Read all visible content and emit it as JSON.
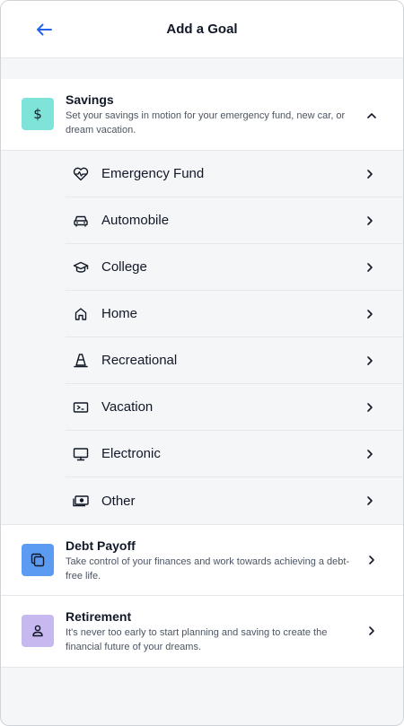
{
  "header": {
    "title": "Add a Goal",
    "back_icon": "arrow-left-icon"
  },
  "colors": {
    "accent": "#2563eb",
    "savings_icon_bg": "#7ee3d8",
    "debt_icon_bg": "#5b9cf2",
    "retirement_icon_bg": "#c7b8ef"
  },
  "savings": {
    "title": "Savings",
    "description": "Set your savings in motion for your emergency fund, new car, or dream vacation.",
    "icon": "dollar-icon",
    "expanded": true,
    "items": [
      {
        "label": "Emergency Fund",
        "icon": "heart-pulse-icon"
      },
      {
        "label": "Automobile",
        "icon": "car-icon"
      },
      {
        "label": "College",
        "icon": "graduation-cap-icon"
      },
      {
        "label": "Home",
        "icon": "home-icon"
      },
      {
        "label": "Recreational",
        "icon": "traffic-cone-icon"
      },
      {
        "label": "Vacation",
        "icon": "ticket-icon"
      },
      {
        "label": "Electronic",
        "icon": "monitor-icon"
      },
      {
        "label": "Other",
        "icon": "money-icon"
      }
    ]
  },
  "debt_payoff": {
    "title": "Debt Payoff",
    "description": "Take control of your finances and work towards achieving a debt-free life.",
    "icon": "cards-icon"
  },
  "retirement": {
    "title": "Retirement",
    "description": "It's never too early to start planning and saving to create the financial future of your dreams.",
    "icon": "person-icon"
  }
}
